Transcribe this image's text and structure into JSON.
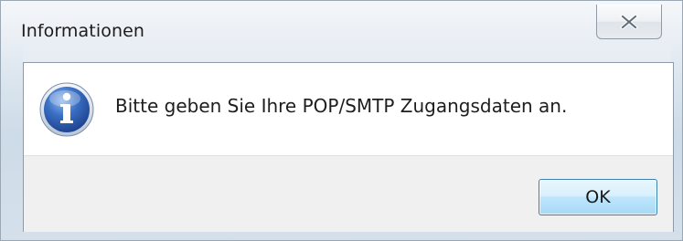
{
  "window": {
    "title": "Informationen"
  },
  "message": {
    "text": "Bitte geben Sie Ihre POP/SMTP Zugangsdaten an.",
    "icon": "info-icon"
  },
  "buttons": {
    "ok_label": "OK",
    "close_icon": "close-icon"
  },
  "colors": {
    "icon_blue": "#2a5fb0",
    "ok_border": "#3c7fb1",
    "content_bg": "#ffffff",
    "footer_bg": "#f0f0f0"
  }
}
